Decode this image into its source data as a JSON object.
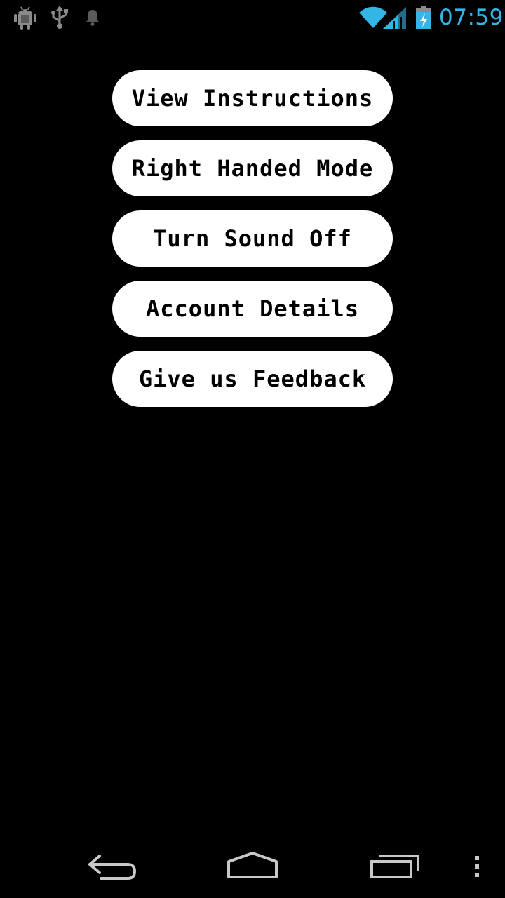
{
  "status_bar": {
    "time": "07:59",
    "icons": [
      "android-debug-icon",
      "usb-icon",
      "notification-bell-icon",
      "wifi-icon",
      "signal-icon",
      "battery-charging-icon"
    ],
    "time_color": "#33b5e5"
  },
  "menu": {
    "buttons": [
      {
        "label": "View Instructions"
      },
      {
        "label": "Right Handed Mode"
      },
      {
        "label": "Turn Sound Off"
      },
      {
        "label": "Account Details"
      },
      {
        "label": "Give us Feedback"
      }
    ]
  },
  "nav_bar": {
    "icons": [
      "back-icon",
      "home-icon",
      "recent-apps-icon",
      "overflow-menu-icon"
    ]
  }
}
